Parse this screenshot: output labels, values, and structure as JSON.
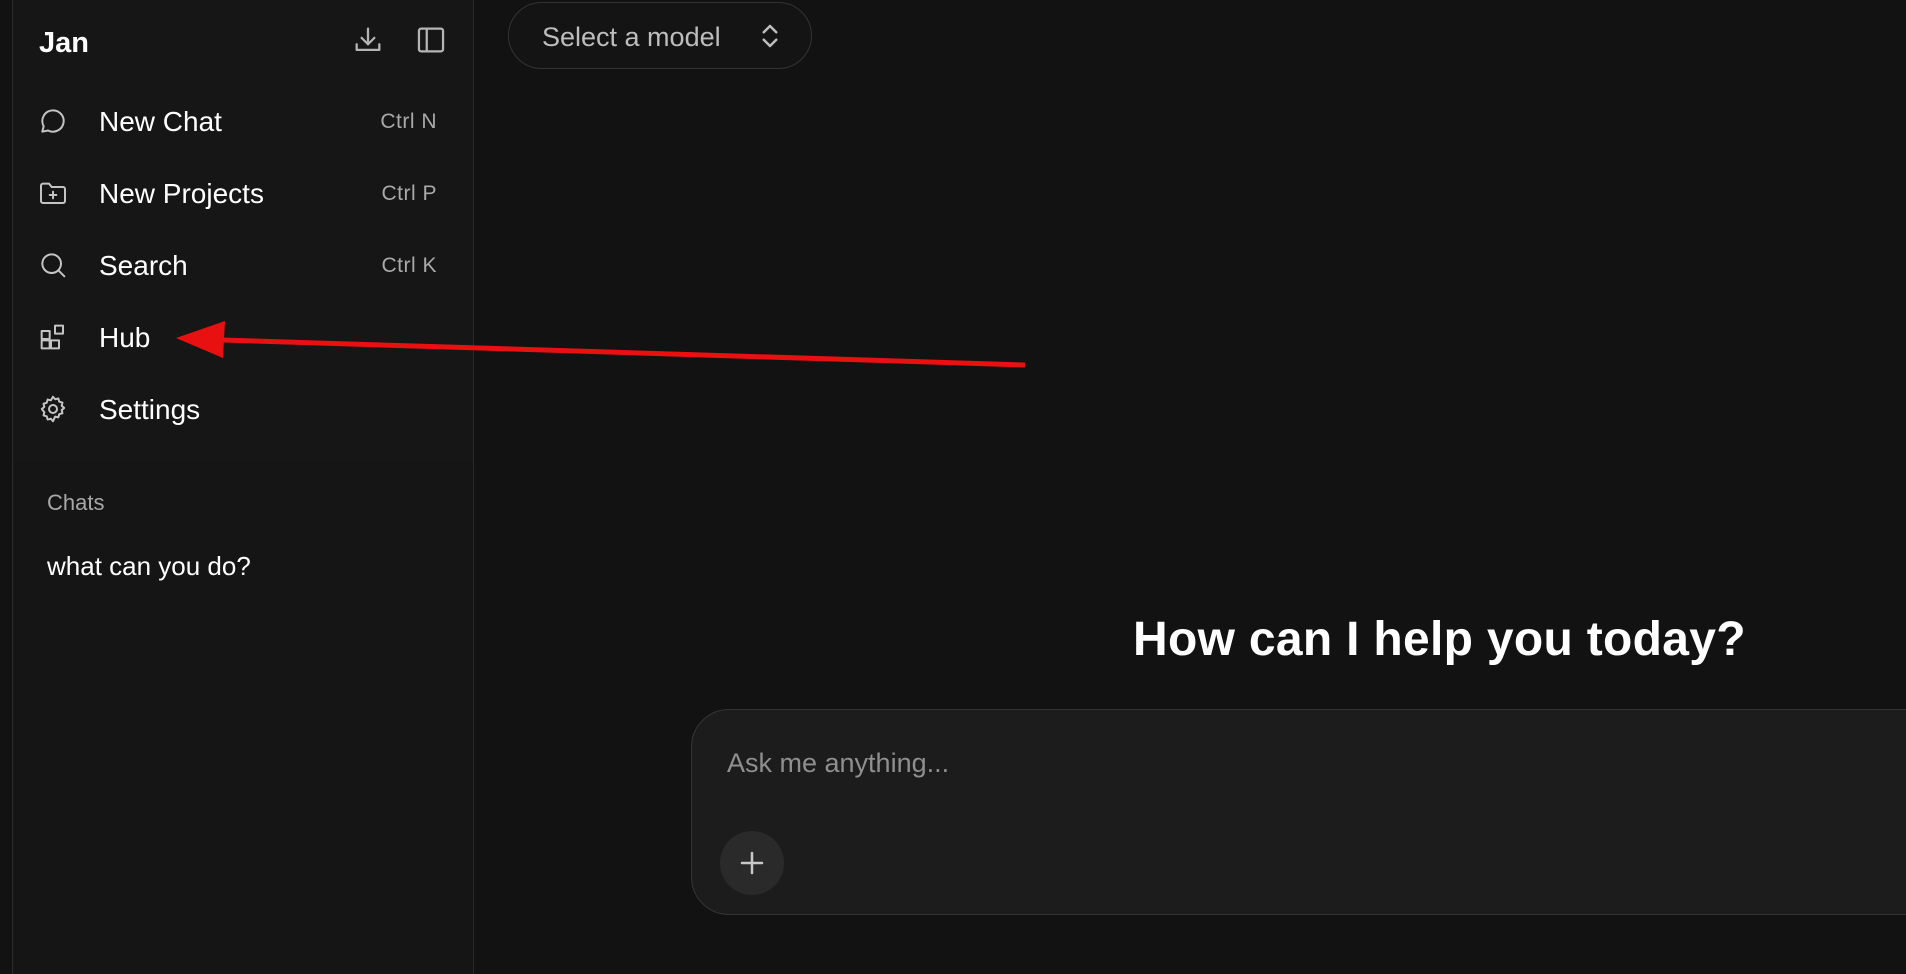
{
  "sidebar": {
    "brand": "Jan",
    "items": [
      {
        "label": "New Chat",
        "shortcut": "Ctrl  N",
        "icon": "chat-bubble-icon"
      },
      {
        "label": "New Projects",
        "shortcut": "Ctrl  P",
        "icon": "folder-plus-icon"
      },
      {
        "label": "Search",
        "shortcut": "Ctrl  K",
        "icon": "search-icon"
      },
      {
        "label": "Hub",
        "shortcut": "",
        "icon": "hub-grid-icon"
      },
      {
        "label": "Settings",
        "shortcut": "",
        "icon": "gear-icon"
      }
    ],
    "chats_title": "Chats",
    "chats": [
      {
        "title": "what can you do?"
      }
    ]
  },
  "header": {
    "model_select_label": "Select a model"
  },
  "main": {
    "headline": "How can I help you today?",
    "prompt_placeholder": "Ask me anything..."
  },
  "colors": {
    "background": "#121212",
    "sidebar": "#151515",
    "prompt_box": "#1c1c1c",
    "annotation_arrow": "#e81010"
  }
}
